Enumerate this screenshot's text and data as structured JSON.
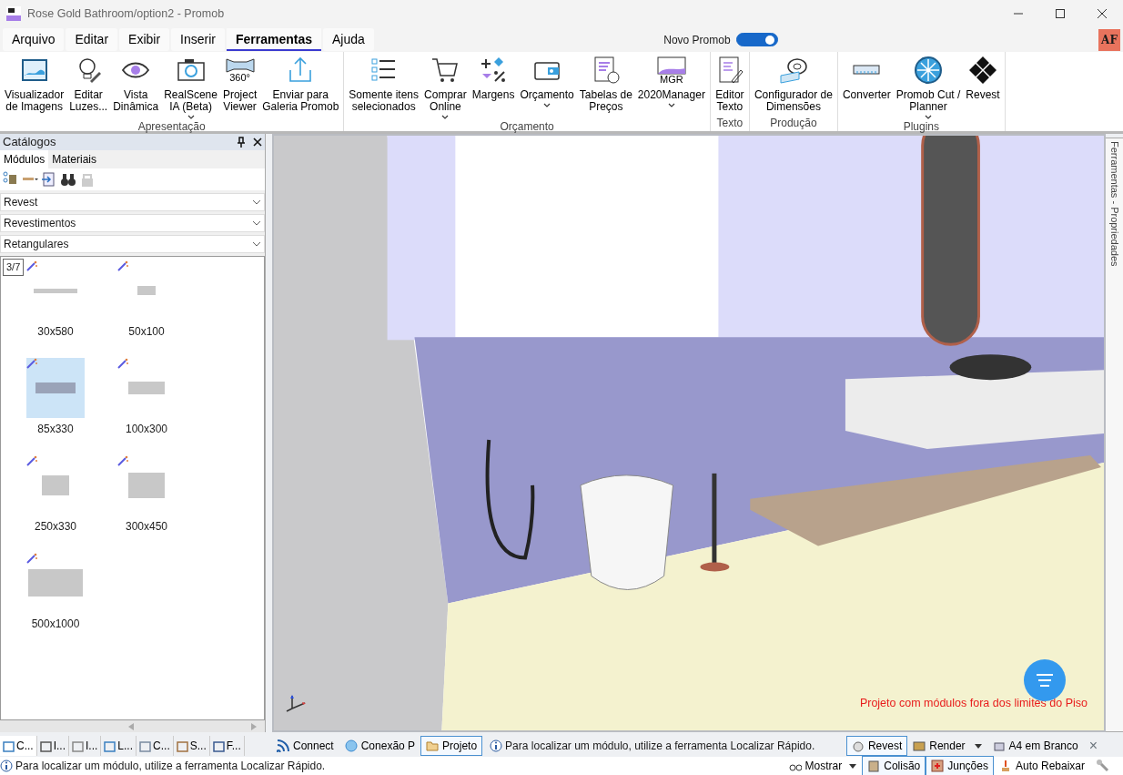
{
  "window": {
    "title": "Rose Gold Bathroom/option2 - Promob"
  },
  "menu": [
    {
      "label": "Arquivo",
      "selected": false
    },
    {
      "label": "Editar",
      "selected": false
    },
    {
      "label": "Exibir",
      "selected": false
    },
    {
      "label": "Inserir",
      "selected": false
    },
    {
      "label": "Ferramentas",
      "selected": true
    },
    {
      "label": "Ajuda",
      "selected": false
    }
  ],
  "novo_promob": {
    "label": "Novo Promob",
    "on": true
  },
  "user_badge": "AF",
  "ribbon_groups": [
    {
      "label": "Apresentação",
      "buttons": [
        {
          "label": "Visualizador\nde Imagens",
          "dropdown": false
        },
        {
          "label": "Editar\nLuzes...",
          "dropdown": false
        },
        {
          "label": "Vista\nDinâmica",
          "dropdown": false
        },
        {
          "label": "RealScene\nIA (Beta)",
          "dropdown": true
        },
        {
          "label": "Project\nViewer",
          "dropdown": false,
          "icon_text": "360°"
        },
        {
          "label": "Enviar para\nGaleria Promob",
          "dropdown": false
        }
      ]
    },
    {
      "label": "Orçamento",
      "buttons": [
        {
          "label": "Somente itens\nselecionados",
          "dropdown": false
        },
        {
          "label": "Comprar\nOnline",
          "dropdown": true
        },
        {
          "label": "Margens",
          "dropdown": false
        },
        {
          "label": "Orçamento",
          "dropdown": true
        },
        {
          "label": "Tabelas de\nPreços",
          "dropdown": false
        },
        {
          "label": "2020Manager",
          "dropdown": true,
          "icon_text": "MGR"
        }
      ]
    },
    {
      "label": "Texto",
      "buttons": [
        {
          "label": "Editor\nTexto",
          "dropdown": false
        }
      ]
    },
    {
      "label": "Produção",
      "buttons": [
        {
          "label": "Configurador de\nDimensões",
          "dropdown": false
        }
      ]
    },
    {
      "label": "Plugins",
      "buttons": [
        {
          "label": "Converter",
          "dropdown": false
        },
        {
          "label": "Promob Cut /\nPlanner",
          "dropdown": true
        },
        {
          "label": "Revest",
          "dropdown": false
        }
      ]
    }
  ],
  "catalog": {
    "title": "Catálogos",
    "tabs": [
      {
        "label": "Módulos",
        "selected": true
      },
      {
        "label": "Materiais",
        "selected": false
      }
    ],
    "selects": [
      "Revest",
      "Revestimentos",
      "Retangulares"
    ],
    "page": "3/7",
    "items": [
      {
        "label": "30x580",
        "selected": false
      },
      {
        "label": "50x100",
        "selected": false
      },
      {
        "label": "85x330",
        "selected": true
      },
      {
        "label": "100x300",
        "selected": false
      },
      {
        "label": "250x330",
        "selected": false
      },
      {
        "label": "300x450",
        "selected": false
      },
      {
        "label": "500x1000",
        "selected": false
      }
    ],
    "bottom_tabs": [
      {
        "label": "C...",
        "selected": true
      },
      {
        "label": "I...",
        "selected": false
      },
      {
        "label": "I...",
        "selected": false
      },
      {
        "label": "L...",
        "selected": false
      },
      {
        "label": "C...",
        "selected": false
      },
      {
        "label": "S...",
        "selected": false
      },
      {
        "label": "F...",
        "selected": false
      }
    ]
  },
  "viewport": {
    "kind": "picture",
    "warning": "Projeto com módulos fora dos limites do Piso"
  },
  "side_tab": "Ferramentas - Propriedades",
  "doc_bar": {
    "left": [
      {
        "label": "Connect",
        "selected": false
      },
      {
        "label": "Conexão P",
        "selected": false
      },
      {
        "label": "Projeto",
        "selected": true
      }
    ],
    "message": "Para localizar um módulo, utilize a ferramenta Localizar Rápido.",
    "right": [
      {
        "label": "Revest",
        "selected": true,
        "dropdown": false
      },
      {
        "label": "Render",
        "selected": false,
        "dropdown": true
      },
      {
        "label": "A4 em Branco",
        "selected": false,
        "dropdown": false
      }
    ],
    "close": "×"
  },
  "status_bar": {
    "message": "Para localizar um módulo, utilize a ferramenta Localizar Rápido.",
    "toggles": [
      {
        "label": "Mostrar",
        "selected": false,
        "dropdown": true
      },
      {
        "label": "Colisão",
        "selected": true,
        "dropdown": false
      },
      {
        "label": "Junções",
        "selected": true,
        "dropdown": false
      },
      {
        "label": "Auto Rebaixar",
        "selected": false,
        "dropdown": false
      }
    ]
  }
}
